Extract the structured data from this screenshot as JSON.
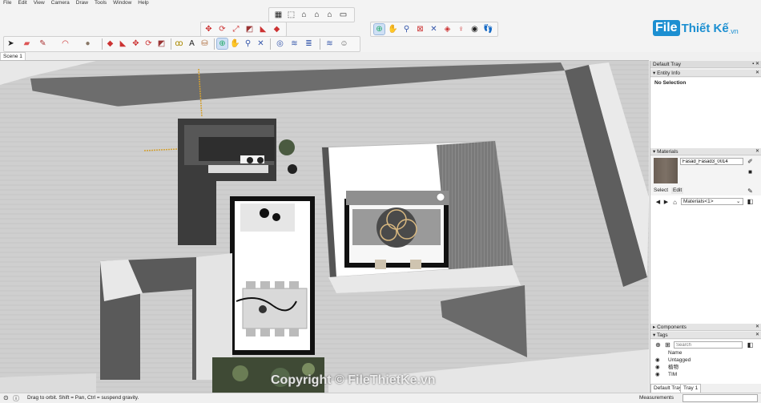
{
  "menu": [
    "File",
    "Edit",
    "View",
    "Camera",
    "Draw",
    "Tools",
    "Window",
    "Help"
  ],
  "toolbar": {
    "row1_icons": [
      "warehouse-icon",
      "iso-view-icon",
      "home-icon",
      "front-view-icon",
      "right-view-icon",
      "back-view-icon"
    ],
    "row2_icons": [
      "move-icon",
      "rotate-icon",
      "scale-icon",
      "offset-icon",
      "follow-me-icon",
      "pushpull-icon"
    ],
    "row3_icons": [
      "select-icon",
      "eraser-icon",
      "pencil-icon",
      "arc-icon",
      "paint-icon",
      "move-icon",
      "rotate-icon",
      "scale-icon",
      "pushpull-icon",
      "tape-icon",
      "text-icon",
      "paint-bucket-icon",
      "orbit-icon",
      "pan-icon",
      "zoom-icon",
      "zoom-extents-icon",
      "section-icon",
      "layers-icon",
      "styles-icon",
      "account-icon"
    ],
    "nav_icons": [
      "orbit-icon",
      "pan-icon",
      "zoom-icon",
      "zoom-window-icon",
      "zoom-extents-icon",
      "previous-icon",
      "position-camera-icon",
      "look-around-icon",
      "walk-icon"
    ]
  },
  "logo": {
    "f": "File",
    "rest": "Thiết Kế",
    "tld": ".vn"
  },
  "scene_tab": "Scene 1",
  "tray": {
    "title": "Default Tray",
    "entity_info": {
      "title": "Entity Info",
      "selection": "No Selection"
    },
    "materials": {
      "title": "Materials",
      "material_name": "Fasad_Fasad3_0014",
      "tab_select": "Select",
      "tab_edit": "Edit",
      "library": "Materials<1>"
    },
    "components": {
      "title": "Components"
    },
    "tags": {
      "title": "Tags",
      "search_placeholder": "Search",
      "column_name": "Name",
      "rows": [
        "Untagged",
        "植物",
        "TIM"
      ]
    },
    "bottom_tabs": [
      "Default Tray",
      "Tray 1"
    ]
  },
  "status": {
    "message": "Drag to orbit. Shift = Pan, Ctrl = suspend gravity.",
    "measurements_label": "Measurements"
  },
  "watermark": "Copyright © FileThietKe.vn"
}
